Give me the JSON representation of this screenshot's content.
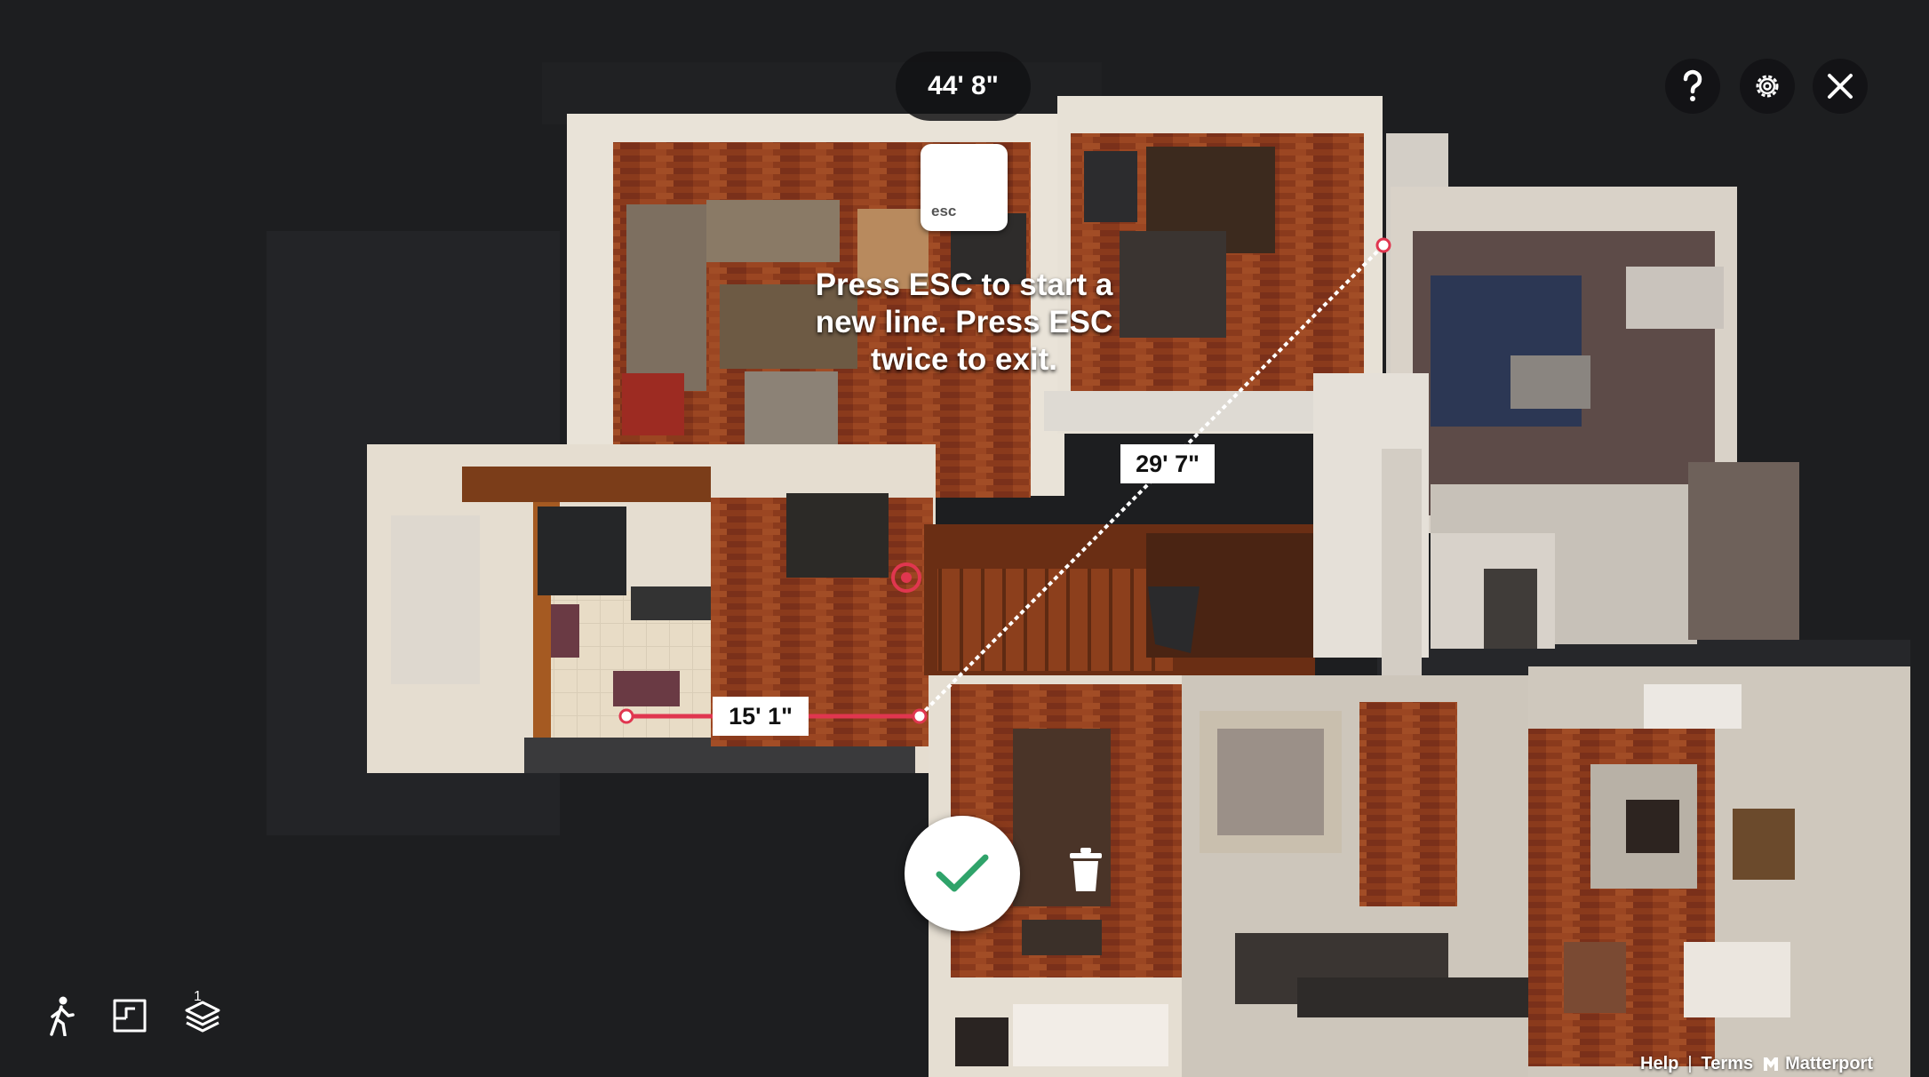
{
  "measurement": {
    "total": "44' 8\"",
    "segments": [
      "15' 1\"",
      "29' 7\""
    ]
  },
  "instruction": {
    "key_label": "esc",
    "text": "Press ESC to start a new line. Press ESC twice to exit."
  },
  "toolbar_top": {
    "help_icon": "question-icon",
    "settings_icon": "gear-icon",
    "close_icon": "close-icon"
  },
  "actions": {
    "confirm_icon": "checkmark-icon",
    "delete_icon": "trash-icon"
  },
  "view_modes": {
    "modes": [
      "walk-icon",
      "floorplan-icon",
      "floors-icon"
    ],
    "floor_number": "1"
  },
  "footer": {
    "help": "Help",
    "separator": "|",
    "terms": "Terms",
    "brand": "Matterport"
  },
  "colors": {
    "measure_line": "#e0364f",
    "confirm_check": "#2fa36a",
    "background": "#1d1e20"
  }
}
